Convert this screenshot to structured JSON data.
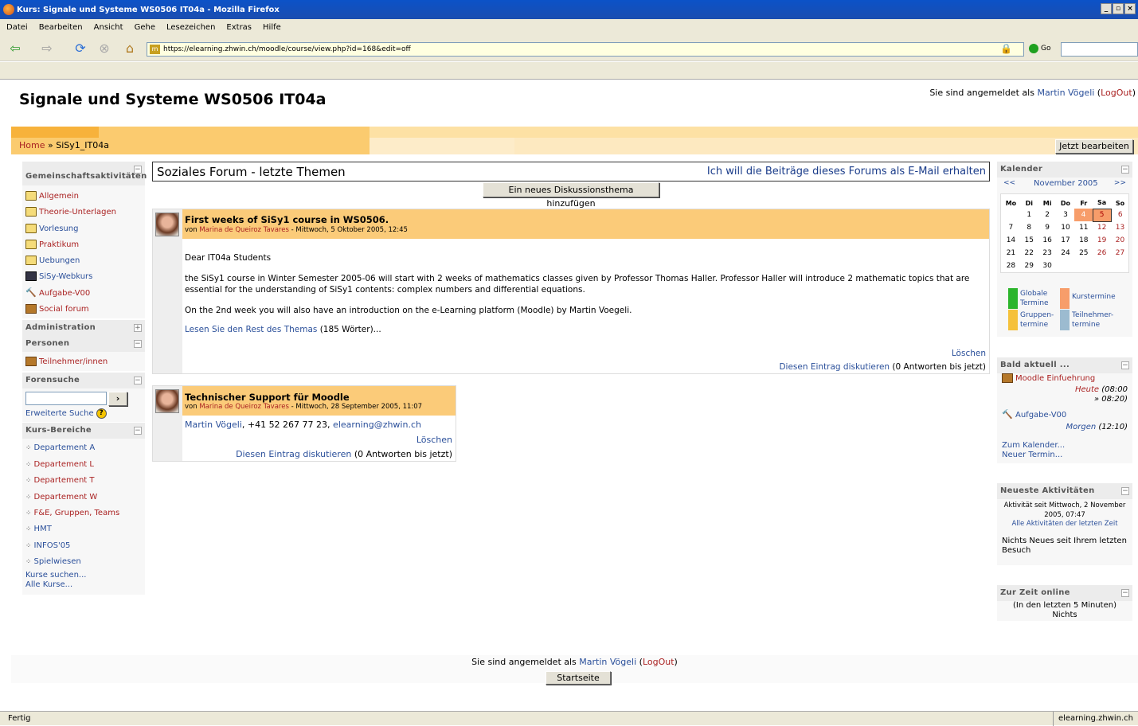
{
  "browser": {
    "window_title": "Kurs: Signale und Systeme WS0506 IT04a - Mozilla Firefox",
    "menu": [
      "Datei",
      "Bearbeiten",
      "Ansicht",
      "Gehe",
      "Lesezeichen",
      "Extras",
      "Hilfe"
    ],
    "url": "https://elearning.zhwin.ch/moodle/course/view.php?id=168&edit=off",
    "go_label": "Go",
    "status_left": "Fertig",
    "status_right": "elearning.zhwin.ch"
  },
  "header": {
    "course_title": "Signale und Systeme WS0506 IT04a",
    "login_prefix": "Sie sind angemeldet als",
    "user_name": "Martin Vögeli",
    "logout": "LogOut",
    "breadcrumb_home": "Home",
    "breadcrumb_sep": "»",
    "breadcrumb_course": "SiSy1_IT04a",
    "edit_button": "Jetzt bearbeiten"
  },
  "left": {
    "activities_title": "Gemeinschaftsaktivitäten",
    "activities": [
      {
        "label": "Allgemein",
        "icon": "folder-icon"
      },
      {
        "label": "Theorie-Unterlagen",
        "icon": "folder-icon"
      },
      {
        "label": "Vorlesung",
        "icon": "folder-icon"
      },
      {
        "label": "Praktikum",
        "icon": "folder-icon"
      },
      {
        "label": "Uebungen",
        "icon": "folder-icon"
      },
      {
        "label": "SiSy-Webkurs",
        "icon": "book-icon"
      },
      {
        "label": "Aufgabe-V00",
        "icon": "assignment-icon"
      },
      {
        "label": "Social forum",
        "icon": "forum-icon"
      }
    ],
    "administration_title": "Administration",
    "persons_title": "Personen",
    "participants": "Teilnehmer/innen",
    "forum_search_title": "Forensuche",
    "search_button": "›",
    "advanced_search": "Erweiterte Suche",
    "categories_title": "Kurs-Bereiche",
    "categories": [
      "Departement A",
      "Departement L",
      "Departement T",
      "Departement W",
      "F&E, Gruppen, Teams",
      "HMT",
      "INFOS'05",
      "Spielwiesen"
    ],
    "search_courses": "Kurse suchen...",
    "all_courses": "Alle Kurse..."
  },
  "forum": {
    "title": "Soziales Forum - letzte Themen",
    "subscribe": "Ich will die Beiträge dieses Forums als E-Mail erhalten",
    "add_topic": "Ein neues Diskussionsthema hinzufügen",
    "posts": [
      {
        "subject": "First weeks of SiSy1 course in WS0506.",
        "by_prefix": "von",
        "author": "Marina de Queiroz Tavares",
        "date": "- Mittwoch, 5 Oktober 2005, 12:45",
        "p1": "Dear IT04a Students",
        "p2": "the SiSy1 course in Winter Semester 2005-06 will start with 2 weeks of mathematics classes given by Professor Thomas Haller. Professor Haller will introduce 2 mathematic topics that are essential for the understanding of SiSy1 contents: complex numbers and differential equations.",
        "p3": "On the 2nd week you will also have an introduction on the e-Learning platform (Moodle) by Martin Voegeli.",
        "read_more": "Lesen Sie den Rest des Themas",
        "word_count": "(185 Wörter)...",
        "delete": "Löschen",
        "discuss": "Diesen Eintrag diskutieren",
        "replies": "(0 Antworten bis jetzt)"
      },
      {
        "subject": "Technischer Support für Moodle",
        "by_prefix": "von",
        "author": "Marina de Queiroz Tavares",
        "date": "- Mittwoch, 28 September 2005, 11:07",
        "contact_name": "Martin Vögeli",
        "contact_phone": ", +41 52 267 77 23, ",
        "contact_email": "elearning@zhwin.ch",
        "delete": "Löschen",
        "discuss": "Diesen Eintrag diskutieren",
        "replies": "(0 Antworten bis jetzt)"
      }
    ]
  },
  "calendar": {
    "title": "Kalender",
    "prev": "<<",
    "next": ">>",
    "month": "November 2005",
    "weekdays": [
      "Mo",
      "Di",
      "Mi",
      "Do",
      "Fr",
      "Sa",
      "So"
    ],
    "weeks": [
      [
        "",
        "1",
        "2",
        "3",
        "4",
        "5",
        "6"
      ],
      [
        "7",
        "8",
        "9",
        "10",
        "11",
        "12",
        "13"
      ],
      [
        "14",
        "15",
        "16",
        "17",
        "18",
        "19",
        "20"
      ],
      [
        "21",
        "22",
        "23",
        "24",
        "25",
        "26",
        "27"
      ],
      [
        "28",
        "29",
        "30",
        "",
        "",
        "",
        ""
      ]
    ],
    "legend_global": "Globale Termine",
    "legend_course": "Kurstermine",
    "legend_group": "Gruppen-termine",
    "legend_user": "Teilnehmer-termine",
    "colors": {
      "global": "#2cb52c",
      "course": "#f79d6a",
      "group": "#f5c13b",
      "user": "#9cbbd0"
    }
  },
  "upcoming": {
    "title": "Bald aktuell ...",
    "event1": "Moodle Einfuehrung",
    "event1_day": "Heute",
    "event1_time": "(08:00",
    "event1_end": "» 08:20)",
    "event2": "Aufgabe-V00",
    "event2_day": "Morgen",
    "event2_time": "(12:10)",
    "goto_calendar": "Zum Kalender...",
    "new_event": "Neuer Termin..."
  },
  "recent": {
    "title": "Neueste Aktivitäten",
    "since": "Aktivität seit Mittwoch, 2 November 2005, 07:47",
    "all": "Alle Aktivitäten der letzten Zeit",
    "nothing": "Nichts Neues seit Ihrem letzten Besuch"
  },
  "online": {
    "title": "Zur Zeit online",
    "range": "(In den letzten 5 Minuten)",
    "none": "Nichts"
  },
  "footer": {
    "login_prefix": "Sie sind angemeldet als",
    "user_name": "Martin Vögeli",
    "logout": "LogOut",
    "home_button": "Startseite"
  }
}
